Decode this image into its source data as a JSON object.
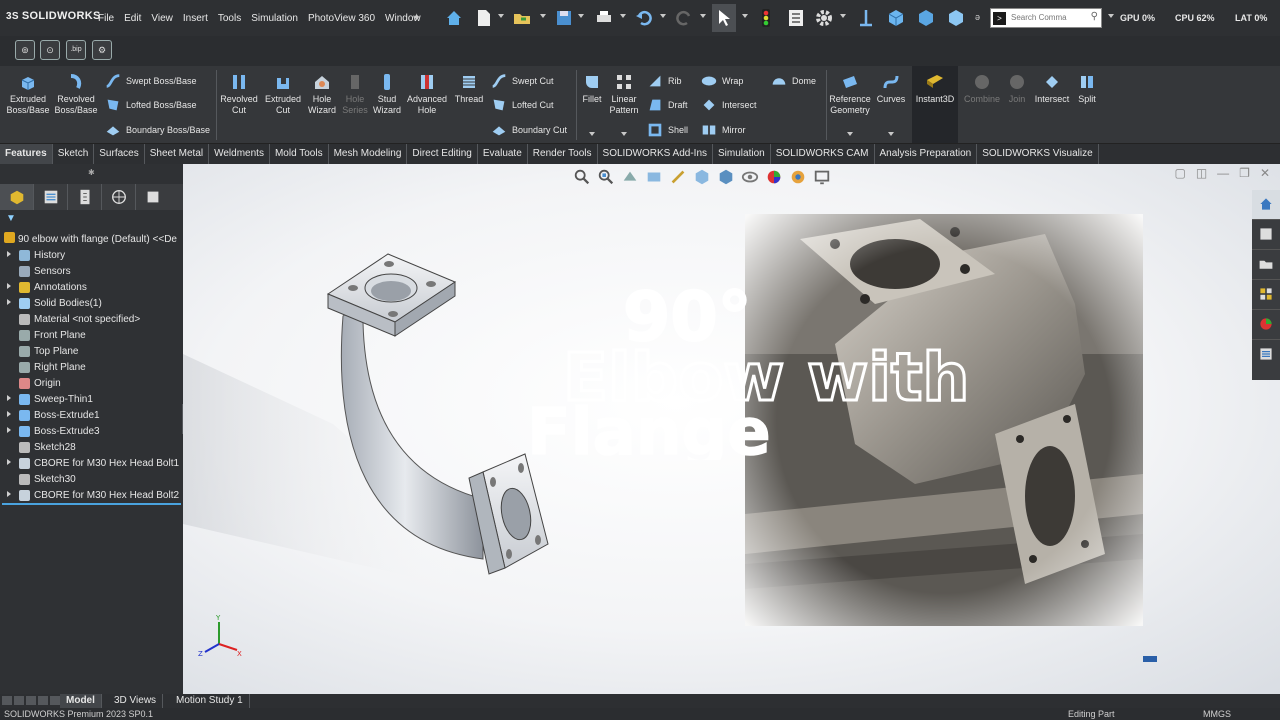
{
  "titlebar": {
    "logo": "SOLIDWORKS",
    "menus": [
      "File",
      "Edit",
      "View",
      "Insert",
      "Tools",
      "Simulation",
      "PhotoView 360",
      "Window"
    ],
    "search_placeholder": "Search Comma",
    "stat_gpu": "GPU 0%",
    "stat_cpu": "CPU 62%",
    "stat_lat": "LAT 0%"
  },
  "row2": {
    "buttons": [
      "⊚",
      "⊙",
      ".bip",
      "⚙"
    ]
  },
  "ribbon": {
    "extruded_boss": "Extruded Boss/Base",
    "revolved_boss": "Revolved Boss/Base",
    "swept_boss": "Swept Boss/Base",
    "lofted_boss": "Lofted Boss/Base",
    "boundary_boss": "Boundary Boss/Base",
    "revolved_cut": "Revolved Cut",
    "extruded_cut": "Extruded Cut",
    "hole_wizard": "Hole Wizard",
    "hole_series": "Hole Series",
    "stud_wizard": "Stud Wizard",
    "advanced_hole": "Advanced Hole",
    "thread": "Thread",
    "swept_cut": "Swept Cut",
    "lofted_cut": "Lofted Cut",
    "boundary_cut": "Boundary Cut",
    "fillet": "Fillet",
    "linear_pattern": "Linear Pattern",
    "rib": "Rib",
    "draft": "Draft",
    "shell": "Shell",
    "wrap": "Wrap",
    "intersect": "Intersect",
    "mirror": "Mirror",
    "dome": "Dome",
    "reference_geometry": "Reference Geometry",
    "curves": "Curves",
    "instant3d": "Instant3D",
    "combine": "Combine",
    "join": "Join",
    "intersect2": "Intersect",
    "split": "Split"
  },
  "tabs": [
    "Features",
    "Sketch",
    "Surfaces",
    "Sheet Metal",
    "Weldments",
    "Mold Tools",
    "Mesh Modeling",
    "Direct Editing",
    "Evaluate",
    "Render Tools",
    "SOLIDWORKS Add-Ins",
    "Simulation",
    "SOLIDWORKS CAM",
    "Analysis Preparation",
    "SOLIDWORKS Visualize"
  ],
  "tree": {
    "root": "90 elbow with flange (Default) <<De",
    "items": [
      {
        "label": "History",
        "expandable": true,
        "icon": "history-icon"
      },
      {
        "label": "Sensors",
        "expandable": false,
        "icon": "sensor-icon"
      },
      {
        "label": "Annotations",
        "expandable": true,
        "icon": "annotation-icon"
      },
      {
        "label": "Solid Bodies(1)",
        "expandable": true,
        "icon": "solid-bodies-icon"
      },
      {
        "label": "Material <not specified>",
        "expandable": false,
        "icon": "material-icon"
      },
      {
        "label": "Front Plane",
        "expandable": false,
        "icon": "plane-icon"
      },
      {
        "label": "Top Plane",
        "expandable": false,
        "icon": "plane-icon"
      },
      {
        "label": "Right Plane",
        "expandable": false,
        "icon": "plane-icon"
      },
      {
        "label": "Origin",
        "expandable": false,
        "icon": "origin-icon"
      },
      {
        "label": "Sweep-Thin1",
        "expandable": true,
        "icon": "sweep-icon"
      },
      {
        "label": "Boss-Extrude1",
        "expandable": true,
        "icon": "extrude-icon"
      },
      {
        "label": "Boss-Extrude3",
        "expandable": true,
        "icon": "extrude-icon"
      },
      {
        "label": "Sketch28",
        "expandable": false,
        "icon": "sketch-icon"
      },
      {
        "label": "CBORE for M30 Hex Head Bolt1",
        "expandable": true,
        "icon": "hole-icon"
      },
      {
        "label": "Sketch30",
        "expandable": false,
        "icon": "sketch-icon"
      },
      {
        "label": "CBORE for M30 Hex Head Bolt2",
        "expandable": true,
        "icon": "hole-icon"
      }
    ]
  },
  "headline": {
    "line1": "90°",
    "line2": "Elbow with",
    "line3": "Flange"
  },
  "triad": {
    "x": "X",
    "y": "Y",
    "z": "Z"
  },
  "bottom_tabs": [
    "Model",
    "3D Views",
    "Motion Study 1"
  ],
  "status": {
    "version": "SOLIDWORKS Premium 2023 SP0.1",
    "mode": "Editing Part",
    "units": "MMGS"
  },
  "colors": {
    "accent": "#4aa3df",
    "panel": "#2f3134",
    "ribbon": "#35373a"
  }
}
